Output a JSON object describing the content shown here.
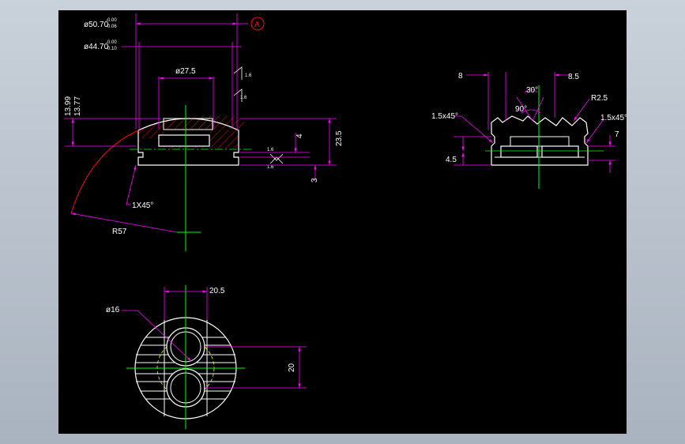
{
  "drawing": {
    "front_view": {
      "dim_d1": "ø50.70",
      "dim_d1_tol_upper": "-0.00",
      "dim_d1_tol_lower": "-0.06",
      "dim_d2": "ø44.70",
      "dim_d2_tol_upper": "-0.00",
      "dim_d2_tol_lower": "-0.10",
      "datum": "A",
      "dim_bore": "ø27.5",
      "dim_h1": "13.99",
      "dim_h2": "13.77",
      "dim_height": "23.5",
      "dim_4": "4",
      "dim_3": "3",
      "rough_1": "1.6",
      "rough_2": "1.6",
      "rough_3": "1.6",
      "rough_4": "1.6",
      "chamfer": "1X45°",
      "radius": "R57"
    },
    "top_view": {
      "dim_width": "20.5",
      "dim_dia": "ø16",
      "dim_spacing": "20"
    },
    "section_view": {
      "dim_8": "8",
      "dim_85": "8.5",
      "angle_30": "30°",
      "angle_90": "90°",
      "radius": "R2.5",
      "chamfer_left": "1.5x45°",
      "chamfer_right": "1.5x45°",
      "dim_45": "4.5",
      "dim_7": "7"
    }
  },
  "colors": {
    "background": "#000000",
    "geometry": "#ffffff",
    "dimension": "#ff00ff",
    "centerline": "#00ff00",
    "hatch": "#ff0000",
    "text": "#ffffff"
  }
}
